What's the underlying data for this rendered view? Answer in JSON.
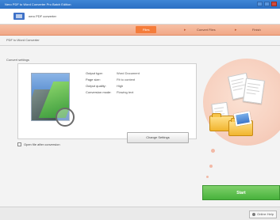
{
  "window": {
    "title": "Nero PDF to Word Converter Pro Batch Edition"
  },
  "toolbar": {
    "app_label": "nero PDF converter"
  },
  "steps": [
    {
      "label": "Files",
      "active": true
    },
    {
      "label": "Convert Files",
      "active": false
    },
    {
      "label": "Finish",
      "active": false
    }
  ],
  "breadcrumb": "PDF to Word Converter",
  "section": {
    "label": "Convert settings"
  },
  "details": {
    "rows": [
      {
        "label": "Output type:",
        "value": "Word Document"
      },
      {
        "label": "Page size:",
        "value": "Fit to content"
      },
      {
        "label": "Output quality:",
        "value": "High"
      },
      {
        "label": "Conversion mode:",
        "value": "Flowing text"
      }
    ],
    "change_button": "Change Settings"
  },
  "checkbox": {
    "label": "Open file after conversion"
  },
  "actions": {
    "start": "Start"
  },
  "status": {
    "link": "Online Help"
  },
  "colors": {
    "accent": "#f57c3a",
    "start": "#47b23c",
    "titlebar": "#2a6fc3"
  }
}
